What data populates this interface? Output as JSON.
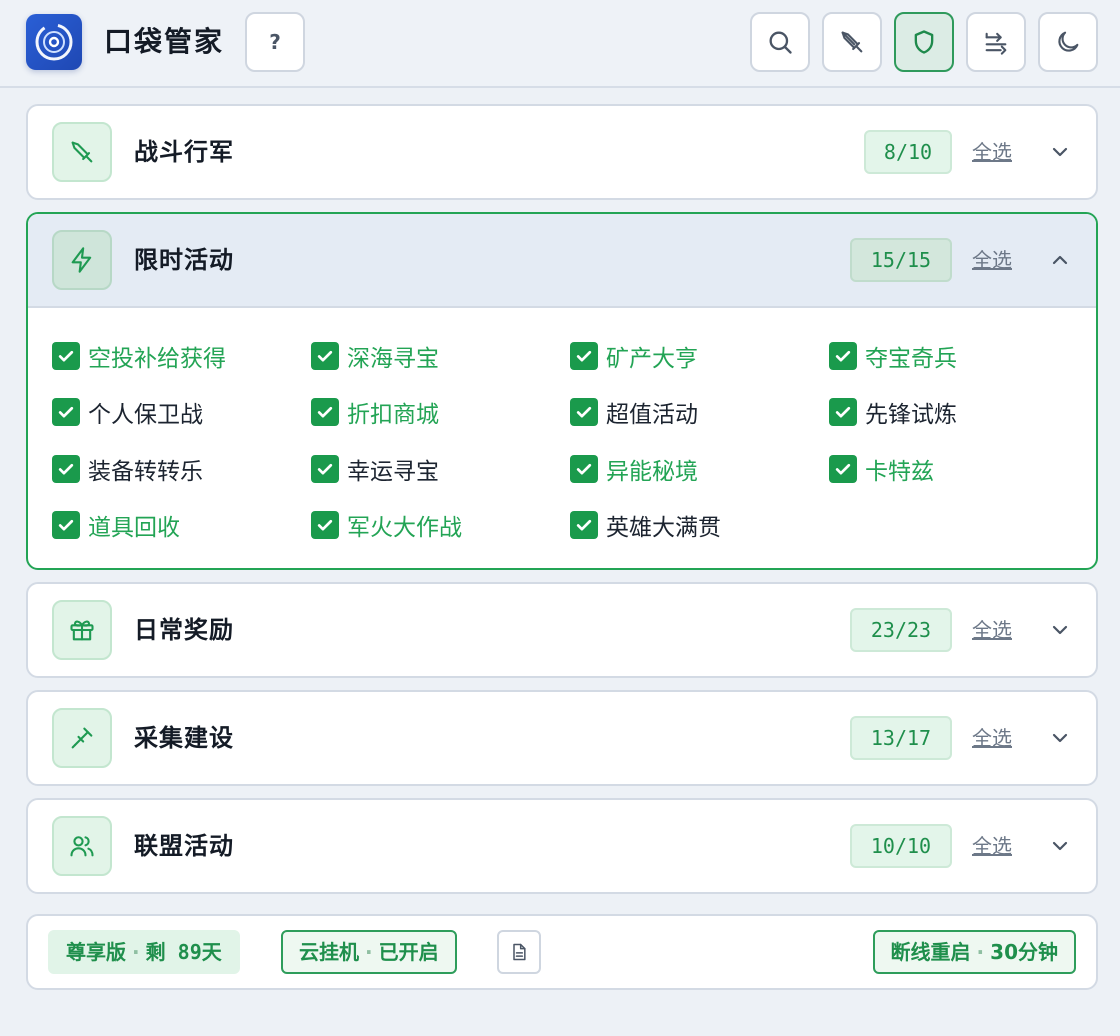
{
  "app": {
    "title": "口袋管家",
    "help_label": "?"
  },
  "header_actions": [
    {
      "name": "search-icon",
      "active": false
    },
    {
      "name": "sword-icon",
      "active": false
    },
    {
      "name": "shield-icon",
      "active": true
    },
    {
      "name": "transfer-icon",
      "active": false
    },
    {
      "name": "moon-icon",
      "active": false
    }
  ],
  "select_all_label": "全选",
  "panels": [
    {
      "id": "battle",
      "title": "战斗行军",
      "count": "8/10",
      "icon": "sword-icon",
      "expanded": false
    },
    {
      "id": "timed",
      "title": "限时活动",
      "count": "15/15",
      "icon": "bolt-icon",
      "expanded": true,
      "items": [
        {
          "label": "空投补给获得",
          "checked": true,
          "highlight": true
        },
        {
          "label": "深海寻宝",
          "checked": true,
          "highlight": true
        },
        {
          "label": "矿产大亨",
          "checked": true,
          "highlight": true
        },
        {
          "label": "夺宝奇兵",
          "checked": true,
          "highlight": true
        },
        {
          "label": "个人保卫战",
          "checked": true,
          "highlight": false
        },
        {
          "label": "折扣商城",
          "checked": true,
          "highlight": true
        },
        {
          "label": "超值活动",
          "checked": true,
          "highlight": false
        },
        {
          "label": "先锋试炼",
          "checked": true,
          "highlight": false
        },
        {
          "label": "装备转转乐",
          "checked": true,
          "highlight": false
        },
        {
          "label": "幸运寻宝",
          "checked": true,
          "highlight": false
        },
        {
          "label": "异能秘境",
          "checked": true,
          "highlight": true
        },
        {
          "label": "卡特兹",
          "checked": true,
          "highlight": true
        },
        {
          "label": "道具回收",
          "checked": true,
          "highlight": true
        },
        {
          "label": "军火大作战",
          "checked": true,
          "highlight": true
        },
        {
          "label": "英雄大满贯",
          "checked": true,
          "highlight": false
        }
      ]
    },
    {
      "id": "daily",
      "title": "日常奖励",
      "count": "23/23",
      "icon": "gift-icon",
      "expanded": false
    },
    {
      "id": "gather",
      "title": "采集建设",
      "count": "13/17",
      "icon": "tool-icon",
      "expanded": false
    },
    {
      "id": "alliance",
      "title": "联盟活动",
      "count": "10/10",
      "icon": "users-icon",
      "expanded": false
    }
  ],
  "footer": {
    "vip": {
      "label": "尊享版",
      "sep": "·",
      "remain": "剩 89天"
    },
    "cloud": {
      "label": "云挂机",
      "sep": "·",
      "status": "已开启"
    },
    "reconnect": {
      "label": "断线重启",
      "sep": "·",
      "interval": "30分钟"
    }
  },
  "colors": {
    "accent": "#23a455",
    "brand": "#2a5fd6",
    "background": "#edf1f6"
  }
}
